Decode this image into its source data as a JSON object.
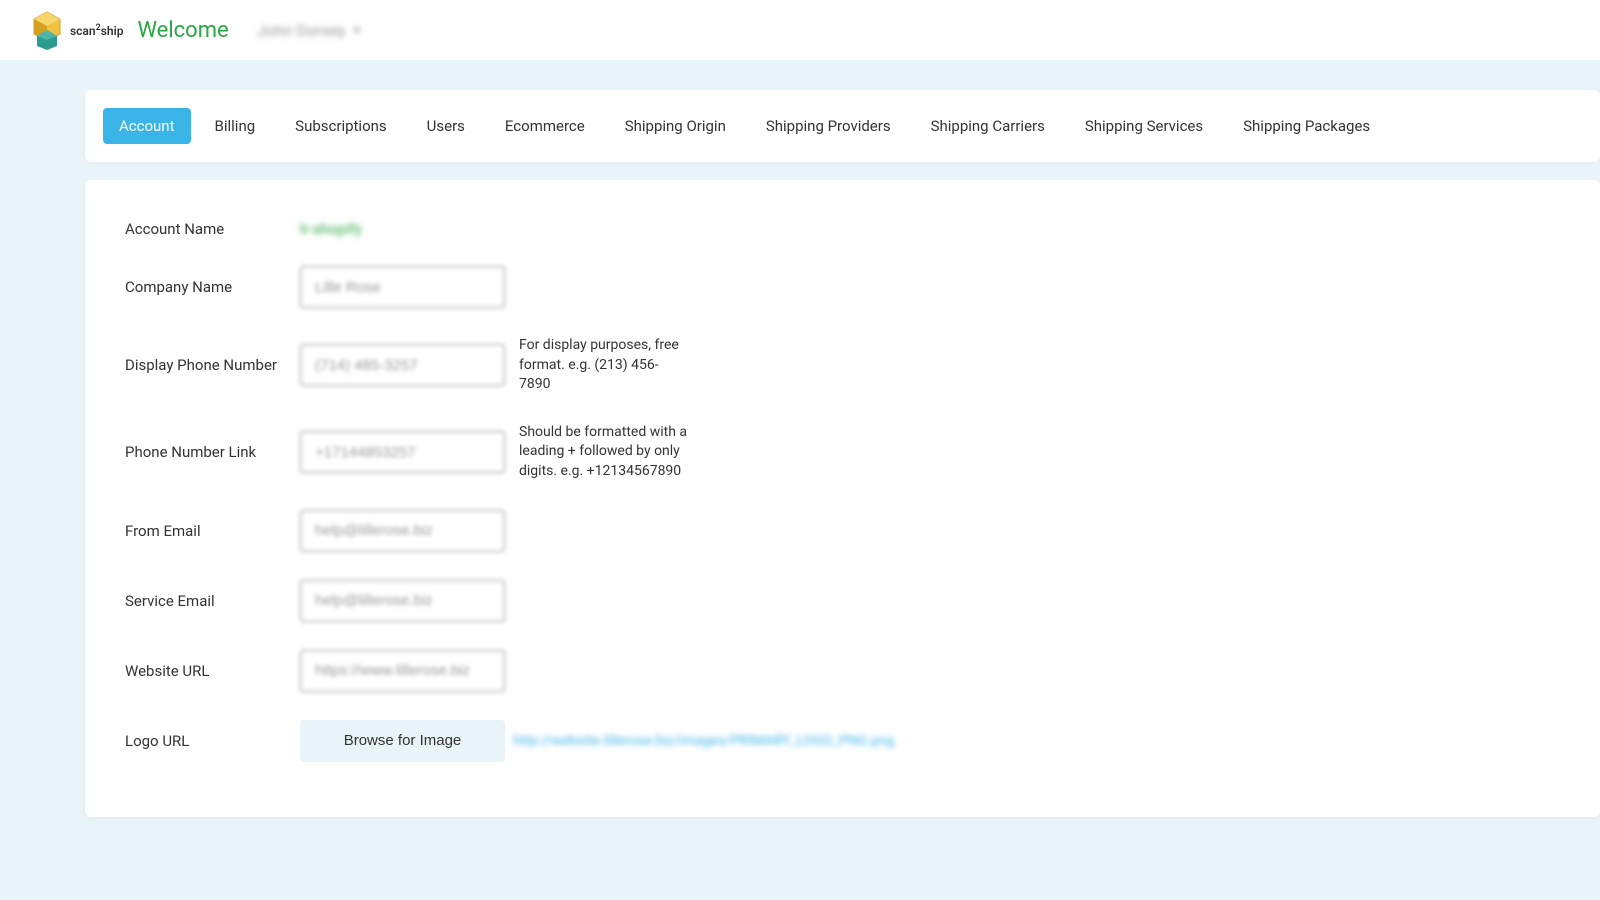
{
  "header": {
    "brand": "scan²ship",
    "welcome": "Welcome",
    "user": "John Dorsey"
  },
  "tabs": [
    {
      "label": "Account",
      "active": true
    },
    {
      "label": "Billing",
      "active": false
    },
    {
      "label": "Subscriptions",
      "active": false
    },
    {
      "label": "Users",
      "active": false
    },
    {
      "label": "Ecommerce",
      "active": false
    },
    {
      "label": "Shipping Origin",
      "active": false
    },
    {
      "label": "Shipping Providers",
      "active": false
    },
    {
      "label": "Shipping Carriers",
      "active": false
    },
    {
      "label": "Shipping Services",
      "active": false
    },
    {
      "label": "Shipping Packages",
      "active": false
    }
  ],
  "form": {
    "account_name": {
      "label": "Account Name",
      "value": "lr-shopify"
    },
    "company_name": {
      "label": "Company Name",
      "value": "Lille Rose"
    },
    "display_phone": {
      "label": "Display Phone Number",
      "value": "(714) 485-3257",
      "hint": "For display purposes, free format. e.g. (213) 456-7890"
    },
    "phone_link": {
      "label": "Phone Number Link",
      "value": "+17144853257",
      "hint": "Should be formatted with a leading + followed by only digits. e.g. +12134567890"
    },
    "from_email": {
      "label": "From Email",
      "value": "help@lillerose.biz"
    },
    "service_email": {
      "label": "Service Email",
      "value": "help@lillerose.biz"
    },
    "website_url": {
      "label": "Website URL",
      "value": "https://www.lillerose.biz"
    },
    "logo_url": {
      "label": "Logo URL",
      "button": "Browse for Image",
      "value": "http://website.lillerose.biz/images/PRIMARY_LOGO_PNG.png"
    }
  }
}
